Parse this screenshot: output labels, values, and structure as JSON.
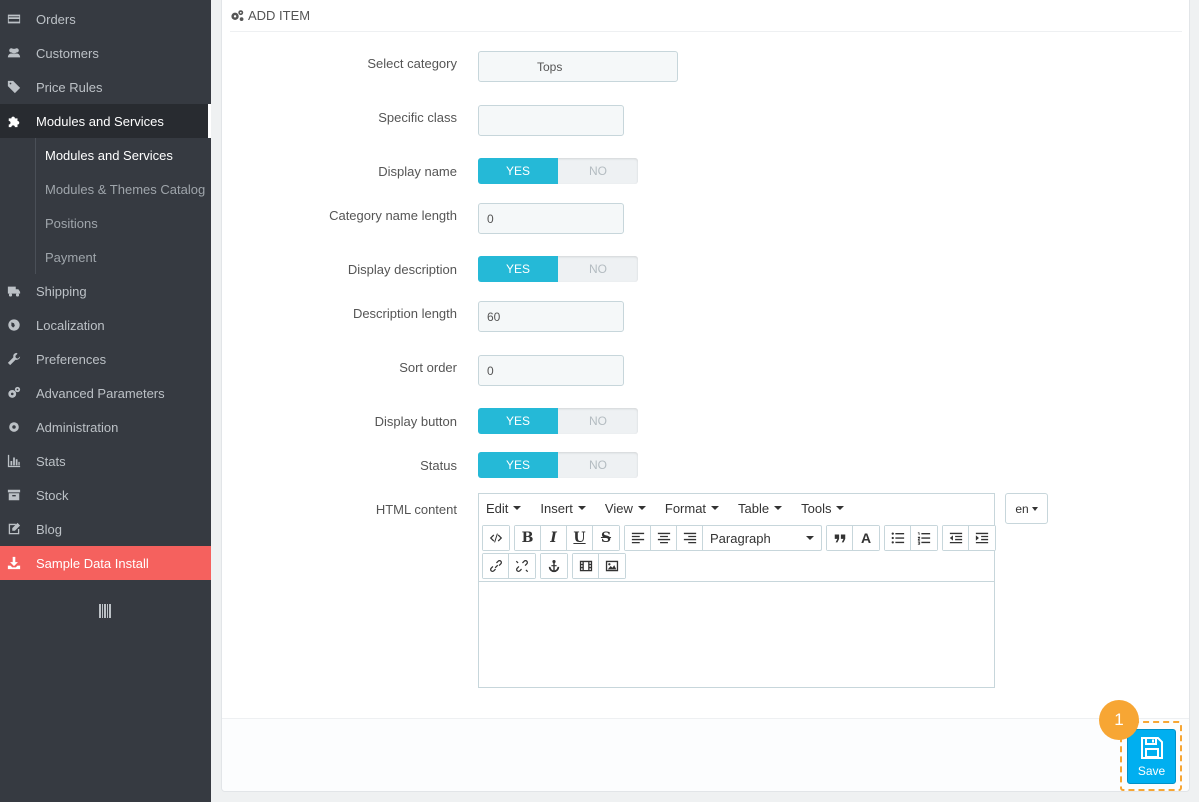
{
  "sidebar": {
    "items": [
      {
        "label": "Orders",
        "icon": "credit-card-icon"
      },
      {
        "label": "Customers",
        "icon": "users-icon"
      },
      {
        "label": "Price Rules",
        "icon": "tags-icon"
      },
      {
        "label": "Modules and Services",
        "icon": "puzzle-icon"
      },
      {
        "label": "Shipping",
        "icon": "truck-icon"
      },
      {
        "label": "Localization",
        "icon": "globe-icon"
      },
      {
        "label": "Preferences",
        "icon": "wrench-icon"
      },
      {
        "label": "Advanced Parameters",
        "icon": "cogs-icon"
      },
      {
        "label": "Administration",
        "icon": "cog-icon"
      },
      {
        "label": "Stats",
        "icon": "bar-chart-icon"
      },
      {
        "label": "Stock",
        "icon": "archive-icon"
      },
      {
        "label": "Blog",
        "icon": "edit-icon"
      },
      {
        "label": "Sample Data Install",
        "icon": "download-icon"
      }
    ],
    "submenu": [
      {
        "label": "Modules and Services"
      },
      {
        "label": "Modules & Themes Catalog"
      },
      {
        "label": "Positions"
      },
      {
        "label": "Payment"
      }
    ],
    "highlight_color": "#f5615e"
  },
  "panel": {
    "title": "ADD ITEM"
  },
  "form": {
    "select_category": {
      "label": "Select category",
      "value": "Tops"
    },
    "specific_class": {
      "label": "Specific class",
      "value": ""
    },
    "display_name": {
      "label": "Display name",
      "yes": "YES",
      "no": "NO",
      "value": "YES"
    },
    "category_name_length": {
      "label": "Category name length",
      "value": "0"
    },
    "display_description": {
      "label": "Display description",
      "yes": "YES",
      "no": "NO",
      "value": "YES"
    },
    "description_length": {
      "label": "Description length",
      "value": "60"
    },
    "sort_order": {
      "label": "Sort order",
      "value": "0"
    },
    "display_button": {
      "label": "Display button",
      "yes": "YES",
      "no": "NO",
      "value": "YES"
    },
    "status": {
      "label": "Status",
      "yes": "YES",
      "no": "NO",
      "value": "YES"
    },
    "html_content": {
      "label": "HTML content"
    }
  },
  "editor": {
    "menus": [
      "Edit",
      "Insert",
      "View",
      "Format",
      "Table",
      "Tools"
    ],
    "block_format": "Paragraph",
    "language": "en"
  },
  "footer": {
    "save_label": "Save",
    "step_badge": "1"
  },
  "colors": {
    "accent": "#25b9d7",
    "save": "#00aff0",
    "badge": "#f7a634"
  }
}
